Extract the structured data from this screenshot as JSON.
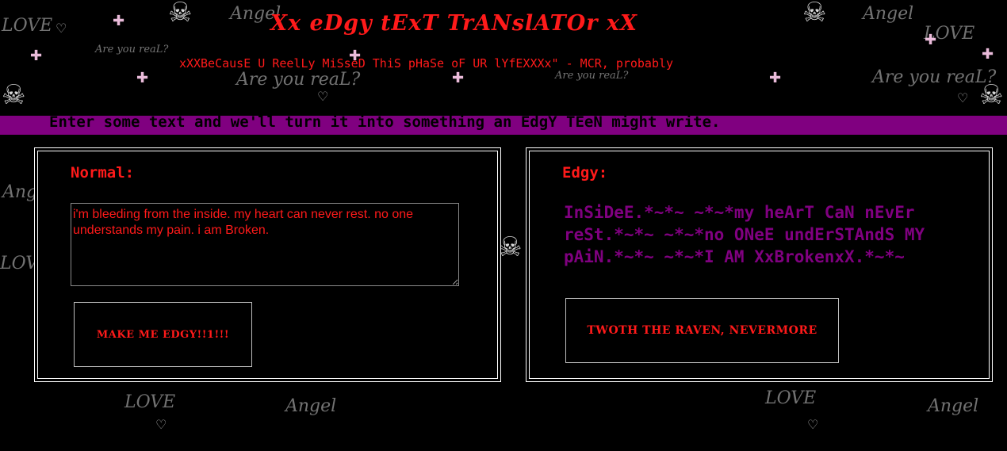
{
  "header": {
    "title": "Xx eDgy tExT TrANslATOr xX",
    "tagline": "xXXBeCausE U ReelLy MiSseD ThiS pHaSe oF UR lYfEXXXx\" - MCR, probably"
  },
  "instructions": "Enter some text and we'll turn it into something an EdgY TEeN might write.",
  "normal_panel": {
    "heading": "Normal:",
    "input_value": "i'm bleeding from the inside. my heart can never rest. no one understands my pain. i am Broken.",
    "button_label": "MAKE ME EDGY!!1!!!"
  },
  "edgy_panel": {
    "heading": "Edgy:",
    "output_text": "InSiDeE.*~*~ ~*~*my heArT CaN nEvEr reSt.*~*~ ~*~*no ONeE undErSTAndS MY pAiN.*~*~ ~*~*I AM XxBrokenxX.*~*~",
    "button_label": "TWOTH THE RAVEN, NEVERMORE"
  },
  "background": {
    "skull": "☠",
    "heart": "♡",
    "sparkle": "✚",
    "angel": "Angel",
    "love": "LOVE",
    "are_you_real": "Are you reaL?"
  },
  "colors": {
    "accent_red": "#ff1a1a",
    "purple": "#800080",
    "background": "#000000",
    "border": "#ffffff"
  }
}
